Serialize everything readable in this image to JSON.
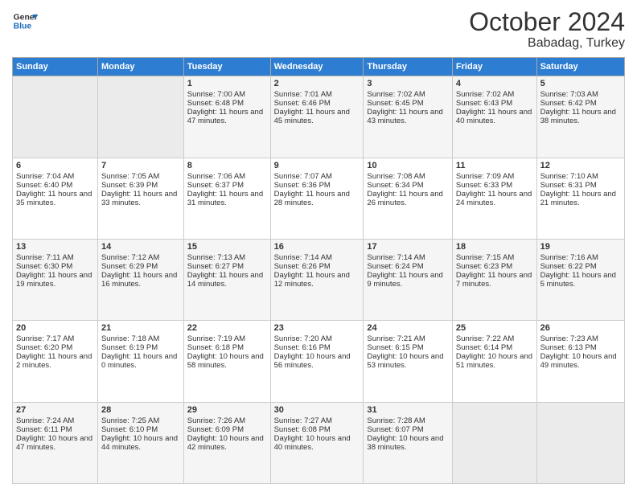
{
  "header": {
    "logo_line1": "General",
    "logo_line2": "Blue",
    "month": "October 2024",
    "location": "Babadag, Turkey"
  },
  "days_of_week": [
    "Sunday",
    "Monday",
    "Tuesday",
    "Wednesday",
    "Thursday",
    "Friday",
    "Saturday"
  ],
  "weeks": [
    [
      {
        "day": "",
        "sunrise": "",
        "sunset": "",
        "daylight": ""
      },
      {
        "day": "",
        "sunrise": "",
        "sunset": "",
        "daylight": ""
      },
      {
        "day": "1",
        "sunrise": "Sunrise: 7:00 AM",
        "sunset": "Sunset: 6:48 PM",
        "daylight": "Daylight: 11 hours and 47 minutes."
      },
      {
        "day": "2",
        "sunrise": "Sunrise: 7:01 AM",
        "sunset": "Sunset: 6:46 PM",
        "daylight": "Daylight: 11 hours and 45 minutes."
      },
      {
        "day": "3",
        "sunrise": "Sunrise: 7:02 AM",
        "sunset": "Sunset: 6:45 PM",
        "daylight": "Daylight: 11 hours and 43 minutes."
      },
      {
        "day": "4",
        "sunrise": "Sunrise: 7:02 AM",
        "sunset": "Sunset: 6:43 PM",
        "daylight": "Daylight: 11 hours and 40 minutes."
      },
      {
        "day": "5",
        "sunrise": "Sunrise: 7:03 AM",
        "sunset": "Sunset: 6:42 PM",
        "daylight": "Daylight: 11 hours and 38 minutes."
      }
    ],
    [
      {
        "day": "6",
        "sunrise": "Sunrise: 7:04 AM",
        "sunset": "Sunset: 6:40 PM",
        "daylight": "Daylight: 11 hours and 35 minutes."
      },
      {
        "day": "7",
        "sunrise": "Sunrise: 7:05 AM",
        "sunset": "Sunset: 6:39 PM",
        "daylight": "Daylight: 11 hours and 33 minutes."
      },
      {
        "day": "8",
        "sunrise": "Sunrise: 7:06 AM",
        "sunset": "Sunset: 6:37 PM",
        "daylight": "Daylight: 11 hours and 31 minutes."
      },
      {
        "day": "9",
        "sunrise": "Sunrise: 7:07 AM",
        "sunset": "Sunset: 6:36 PM",
        "daylight": "Daylight: 11 hours and 28 minutes."
      },
      {
        "day": "10",
        "sunrise": "Sunrise: 7:08 AM",
        "sunset": "Sunset: 6:34 PM",
        "daylight": "Daylight: 11 hours and 26 minutes."
      },
      {
        "day": "11",
        "sunrise": "Sunrise: 7:09 AM",
        "sunset": "Sunset: 6:33 PM",
        "daylight": "Daylight: 11 hours and 24 minutes."
      },
      {
        "day": "12",
        "sunrise": "Sunrise: 7:10 AM",
        "sunset": "Sunset: 6:31 PM",
        "daylight": "Daylight: 11 hours and 21 minutes."
      }
    ],
    [
      {
        "day": "13",
        "sunrise": "Sunrise: 7:11 AM",
        "sunset": "Sunset: 6:30 PM",
        "daylight": "Daylight: 11 hours and 19 minutes."
      },
      {
        "day": "14",
        "sunrise": "Sunrise: 7:12 AM",
        "sunset": "Sunset: 6:29 PM",
        "daylight": "Daylight: 11 hours and 16 minutes."
      },
      {
        "day": "15",
        "sunrise": "Sunrise: 7:13 AM",
        "sunset": "Sunset: 6:27 PM",
        "daylight": "Daylight: 11 hours and 14 minutes."
      },
      {
        "day": "16",
        "sunrise": "Sunrise: 7:14 AM",
        "sunset": "Sunset: 6:26 PM",
        "daylight": "Daylight: 11 hours and 12 minutes."
      },
      {
        "day": "17",
        "sunrise": "Sunrise: 7:14 AM",
        "sunset": "Sunset: 6:24 PM",
        "daylight": "Daylight: 11 hours and 9 minutes."
      },
      {
        "day": "18",
        "sunrise": "Sunrise: 7:15 AM",
        "sunset": "Sunset: 6:23 PM",
        "daylight": "Daylight: 11 hours and 7 minutes."
      },
      {
        "day": "19",
        "sunrise": "Sunrise: 7:16 AM",
        "sunset": "Sunset: 6:22 PM",
        "daylight": "Daylight: 11 hours and 5 minutes."
      }
    ],
    [
      {
        "day": "20",
        "sunrise": "Sunrise: 7:17 AM",
        "sunset": "Sunset: 6:20 PM",
        "daylight": "Daylight: 11 hours and 2 minutes."
      },
      {
        "day": "21",
        "sunrise": "Sunrise: 7:18 AM",
        "sunset": "Sunset: 6:19 PM",
        "daylight": "Daylight: 11 hours and 0 minutes."
      },
      {
        "day": "22",
        "sunrise": "Sunrise: 7:19 AM",
        "sunset": "Sunset: 6:18 PM",
        "daylight": "Daylight: 10 hours and 58 minutes."
      },
      {
        "day": "23",
        "sunrise": "Sunrise: 7:20 AM",
        "sunset": "Sunset: 6:16 PM",
        "daylight": "Daylight: 10 hours and 56 minutes."
      },
      {
        "day": "24",
        "sunrise": "Sunrise: 7:21 AM",
        "sunset": "Sunset: 6:15 PM",
        "daylight": "Daylight: 10 hours and 53 minutes."
      },
      {
        "day": "25",
        "sunrise": "Sunrise: 7:22 AM",
        "sunset": "Sunset: 6:14 PM",
        "daylight": "Daylight: 10 hours and 51 minutes."
      },
      {
        "day": "26",
        "sunrise": "Sunrise: 7:23 AM",
        "sunset": "Sunset: 6:13 PM",
        "daylight": "Daylight: 10 hours and 49 minutes."
      }
    ],
    [
      {
        "day": "27",
        "sunrise": "Sunrise: 7:24 AM",
        "sunset": "Sunset: 6:11 PM",
        "daylight": "Daylight: 10 hours and 47 minutes."
      },
      {
        "day": "28",
        "sunrise": "Sunrise: 7:25 AM",
        "sunset": "Sunset: 6:10 PM",
        "daylight": "Daylight: 10 hours and 44 minutes."
      },
      {
        "day": "29",
        "sunrise": "Sunrise: 7:26 AM",
        "sunset": "Sunset: 6:09 PM",
        "daylight": "Daylight: 10 hours and 42 minutes."
      },
      {
        "day": "30",
        "sunrise": "Sunrise: 7:27 AM",
        "sunset": "Sunset: 6:08 PM",
        "daylight": "Daylight: 10 hours and 40 minutes."
      },
      {
        "day": "31",
        "sunrise": "Sunrise: 7:28 AM",
        "sunset": "Sunset: 6:07 PM",
        "daylight": "Daylight: 10 hours and 38 minutes."
      },
      {
        "day": "",
        "sunrise": "",
        "sunset": "",
        "daylight": ""
      },
      {
        "day": "",
        "sunrise": "",
        "sunset": "",
        "daylight": ""
      }
    ]
  ]
}
